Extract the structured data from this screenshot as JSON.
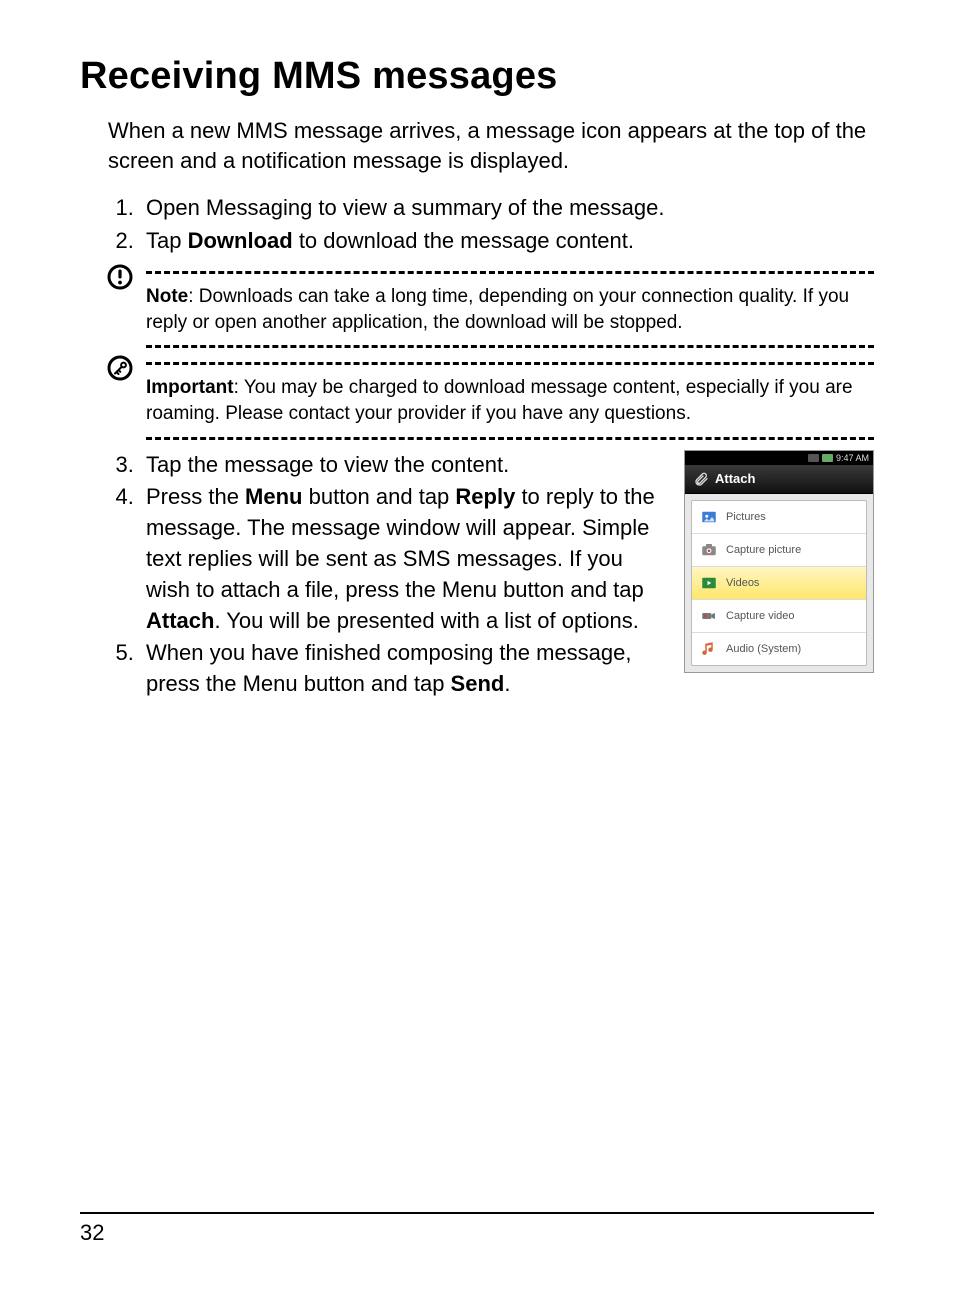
{
  "title": "Receiving MMS messages",
  "intro": "When a new MMS message arrives, a message icon appears at the top of the screen and a notification message is displayed.",
  "steps_a": {
    "s1": "Open Messaging to view a summary of the message.",
    "s2_pre": "Tap ",
    "s2_bold": "Download",
    "s2_post": " to download the message content."
  },
  "note": {
    "label": "Note",
    "text": ": Downloads can take a long time, depending on your connection quality. If you reply or open another application, the download will be stopped."
  },
  "important": {
    "label": "Important",
    "text": ": You may be charged to download message content, especially if you are roaming. Please contact your provider if you have any questions."
  },
  "steps_b": {
    "s3": "Tap the message to view the content.",
    "s4_a": "Press the ",
    "s4_menu": "Menu",
    "s4_b": " button and tap ",
    "s4_reply": "Reply",
    "s4_c": " to reply to the message. The message window will appear. Simple text replies will be sent as SMS messages. If you wish to attach a file, press the Menu button and tap ",
    "s4_attach": "Attach",
    "s4_d": ". You will be presented with a list of options.",
    "s5_a": "When you have finished composing the message, press the Menu button and tap ",
    "s5_send": "Send",
    "s5_b": "."
  },
  "phone": {
    "time": "9:47 AM",
    "header": "Attach",
    "items": {
      "pictures": "Pictures",
      "capture_picture": "Capture picture",
      "videos": "Videos",
      "capture_video": "Capture video",
      "audio_system": "Audio (System)"
    }
  },
  "page_number": "32"
}
